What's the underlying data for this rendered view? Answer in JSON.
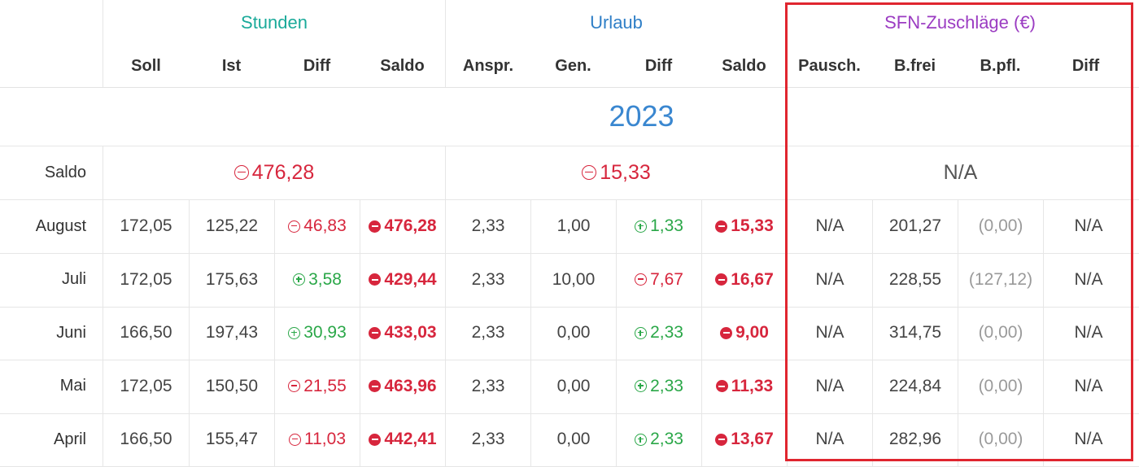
{
  "groups": {
    "stunden": "Stunden",
    "urlaub": "Urlaub",
    "sfn": "SFN-Zuschläge (€)"
  },
  "columns": {
    "stunden": [
      "Soll",
      "Ist",
      "Diff",
      "Saldo"
    ],
    "urlaub": [
      "Anspr.",
      "Gen.",
      "Diff",
      "Saldo"
    ],
    "sfn": [
      "Pausch.",
      "B.frei",
      "B.pfl.",
      "Diff"
    ]
  },
  "year": "2023",
  "saldo": {
    "label": "Saldo",
    "stunden": "476,28",
    "urlaub": "15,33",
    "sfn": "N/A"
  },
  "rows": [
    {
      "month": "August",
      "soll": "172,05",
      "ist": "125,22",
      "diff": "46,83",
      "diff_sign": "minus",
      "saldo": "476,28",
      "anspr": "2,33",
      "gen": "1,00",
      "u_diff": "1,33",
      "u_diff_sign": "plus",
      "u_saldo": "15,33",
      "pausch": "N/A",
      "bfrei": "201,27",
      "bpfl": "(0,00)",
      "sfn_diff": "N/A"
    },
    {
      "month": "Juli",
      "soll": "172,05",
      "ist": "175,63",
      "diff": "3,58",
      "diff_sign": "plus",
      "saldo": "429,44",
      "anspr": "2,33",
      "gen": "10,00",
      "u_diff": "7,67",
      "u_diff_sign": "minus",
      "u_saldo": "16,67",
      "pausch": "N/A",
      "bfrei": "228,55",
      "bpfl": "(127,12)",
      "sfn_diff": "N/A"
    },
    {
      "month": "Juni",
      "soll": "166,50",
      "ist": "197,43",
      "diff": "30,93",
      "diff_sign": "plus",
      "saldo": "433,03",
      "anspr": "2,33",
      "gen": "0,00",
      "u_diff": "2,33",
      "u_diff_sign": "plus",
      "u_saldo": "9,00",
      "pausch": "N/A",
      "bfrei": "314,75",
      "bpfl": "(0,00)",
      "sfn_diff": "N/A"
    },
    {
      "month": "Mai",
      "soll": "172,05",
      "ist": "150,50",
      "diff": "21,55",
      "diff_sign": "minus",
      "saldo": "463,96",
      "anspr": "2,33",
      "gen": "0,00",
      "u_diff": "2,33",
      "u_diff_sign": "plus",
      "u_saldo": "11,33",
      "pausch": "N/A",
      "bfrei": "224,84",
      "bpfl": "(0,00)",
      "sfn_diff": "N/A"
    },
    {
      "month": "April",
      "soll": "166,50",
      "ist": "155,47",
      "diff": "11,03",
      "diff_sign": "minus",
      "saldo": "442,41",
      "anspr": "2,33",
      "gen": "0,00",
      "u_diff": "2,33",
      "u_diff_sign": "plus",
      "u_saldo": "13,67",
      "pausch": "N/A",
      "bfrei": "282,96",
      "bpfl": "(0,00)",
      "sfn_diff": "N/A"
    }
  ],
  "colors": {
    "stunden": "#1aaa9a",
    "urlaub": "#2f7fc7",
    "sfn": "#9b3cc2",
    "negative": "#d7263d",
    "positive": "#2aa748",
    "highlight": "#e0262f"
  }
}
